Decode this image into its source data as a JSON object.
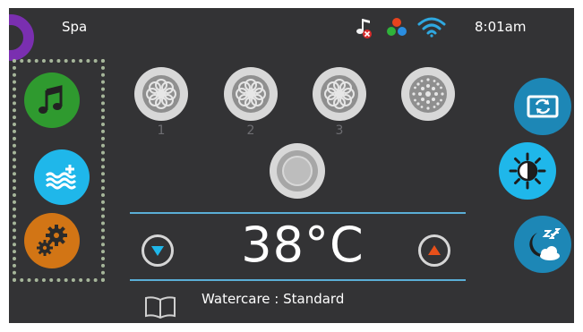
{
  "status_bar": {
    "title": "Spa",
    "time": "8:01am",
    "icons": [
      "music-muted-icon",
      "color-dots-icon",
      "wifi-icon"
    ]
  },
  "pumps": [
    {
      "label": "1",
      "icon": "pump-flower-icon"
    },
    {
      "label": "2",
      "icon": "pump-flower-icon"
    },
    {
      "label": "3",
      "icon": "pump-flower-icon"
    },
    {
      "label": "",
      "icon": "blower-icon"
    }
  ],
  "left_menu": [
    {
      "icon": "music-icon",
      "color": "#2f9a2f"
    },
    {
      "icon": "water-plus-icon",
      "color": "#1fb7ea"
    },
    {
      "icon": "settings-gears-icon",
      "color": "#d27515"
    }
  ],
  "right_menu": [
    {
      "icon": "flip-screen-icon",
      "color": "#1d87b6"
    },
    {
      "icon": "brightness-icon",
      "color": "#1fb7ea"
    },
    {
      "icon": "sleep-moon-icon",
      "color": "#1d87b6"
    }
  ],
  "temperature": {
    "value": "38°C",
    "down_icon": "triangle-down-icon",
    "up_icon": "triangle-up-icon",
    "down_color": "#1fb7ea",
    "up_color": "#e8501a"
  },
  "watercare": {
    "text": "Watercare : Standard",
    "icon": "book-icon"
  },
  "colors": {
    "screen_bg": "#333335",
    "divider": "#5aaed6",
    "logo_accent": "#7a2fb0"
  }
}
